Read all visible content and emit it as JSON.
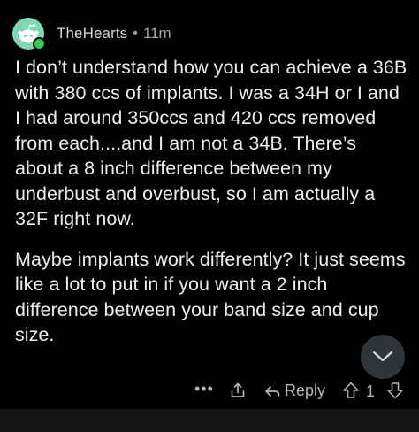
{
  "comment": {
    "author": "TheHearts",
    "separator": "•",
    "time": "11m",
    "paragraphs": [
      "I don’t understand how you can achieve a 36B with 380 ccs of implants. I was a 34H or I and I had around 350ccs and 420 ccs removed from each....and I am not a 34B.  There’s about a 8 inch difference between my underbust and overbust, so I am actually a 32F right now.",
      "Maybe implants work differently? It just seems like a lot to put in if you want a 2 inch difference between your band size and cup size."
    ]
  },
  "actions": {
    "more": "•••",
    "reply_label": "Reply",
    "score": "1"
  },
  "colors": {
    "background": "#000000",
    "avatar": "#7fd7b5",
    "online": "#2ecc52",
    "fab": "#2f3439",
    "text": "#ededed",
    "muted": "#b5b5b5"
  },
  "icons": {
    "avatar": "snoo-avatar-icon",
    "scroll": "chevron-down-icon",
    "share": "share-icon",
    "reply": "reply-arrow-icon",
    "upvote": "upvote-arrow-icon",
    "downvote": "downvote-arrow-icon"
  }
}
